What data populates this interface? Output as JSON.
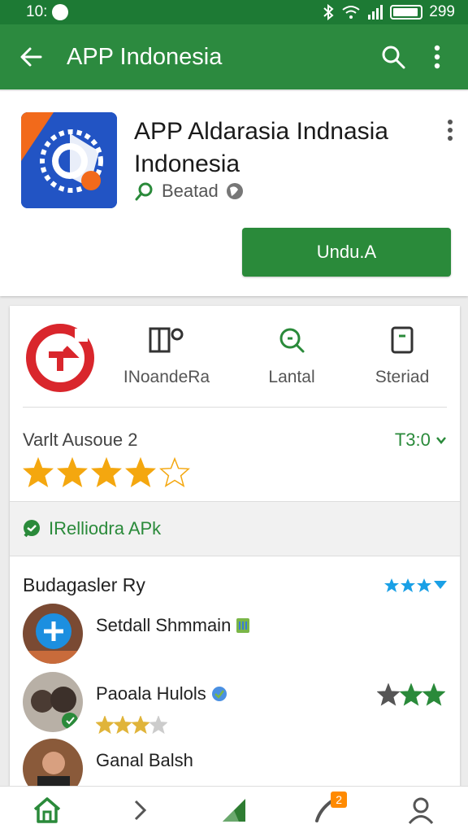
{
  "status_bar": {
    "time": "10:",
    "battery_text": "299"
  },
  "app_bar": {
    "title": "APP Indonesia"
  },
  "app": {
    "title": "APP Aldarasia Indnasia Indonesia",
    "developer": "Beatad",
    "install_label": "Undu.A"
  },
  "stats": [
    {
      "label": "INoandeRa",
      "icon": "book-icon"
    },
    {
      "label": "Lantal",
      "icon": "search-icon"
    },
    {
      "label": "Steriad",
      "icon": "document-icon"
    }
  ],
  "version": {
    "label": "Varlt Ausoue 2",
    "right_text": "T3:0",
    "rating_stars": 4
  },
  "promo": {
    "label": "IRelliodra APk"
  },
  "reviews": {
    "title": "Budagasler Ry",
    "items": [
      {
        "name": "Setdall Shmmain",
        "stars": 0
      },
      {
        "name": "Paoala Hulols",
        "stars": 3
      },
      {
        "name": "Ganal Balsh",
        "stars": 0
      }
    ],
    "right_stars": 3
  },
  "bottom_nav": {
    "badge_count": "2",
    "items": [
      "home-icon",
      "chevron-right-icon",
      "apps-icon",
      "phone-icon",
      "account-icon"
    ]
  },
  "colors": {
    "primary": "#2c8a3f",
    "status_bar": "#1d7a34",
    "accent": "#2a8a3a",
    "star": "#f4a70f",
    "badge": "#ff8a00"
  }
}
